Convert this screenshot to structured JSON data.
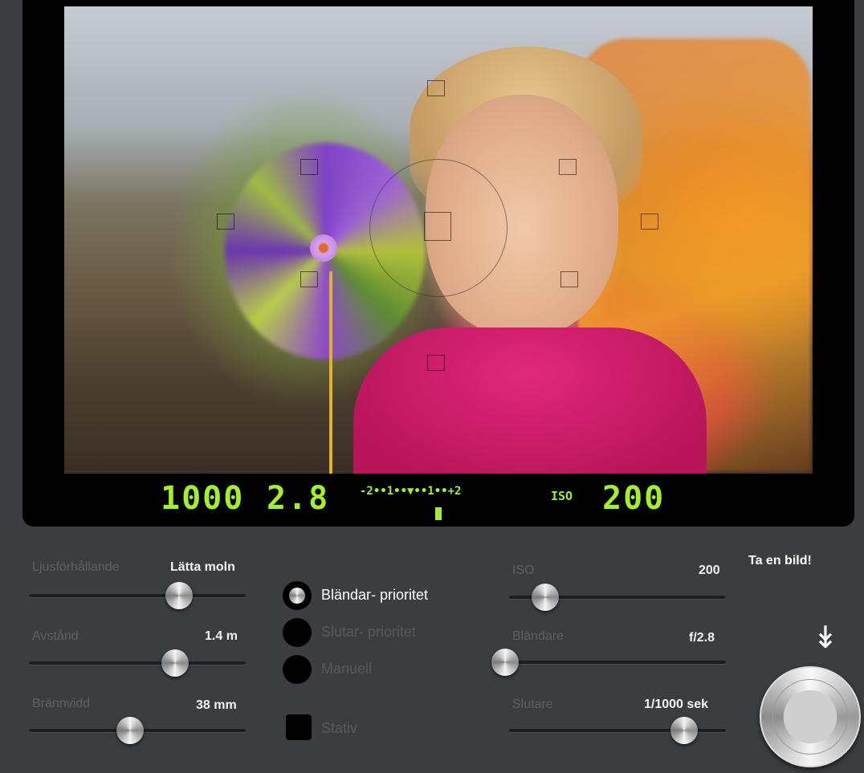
{
  "viewfinder": {
    "shutter_readout": "1000",
    "aperture_readout": "2.8",
    "meter_scale": "-2••1••▼••1••+2",
    "iso_label": "ISO",
    "iso_readout": "200"
  },
  "left_controls": {
    "light": {
      "label": "Ljusförhållande",
      "value": "Lätta moln",
      "level": 0.72
    },
    "distance": {
      "label": "Avstånd",
      "value": "1.4 m",
      "level": 0.7
    },
    "focal": {
      "label": "Brännvidd",
      "value": "38 mm",
      "level": 0.46
    }
  },
  "modes": [
    {
      "label": "Bländar- prioritet",
      "selected": true
    },
    {
      "label": "Slutar- prioritet",
      "selected": false
    },
    {
      "label": "Manuell",
      "selected": false
    }
  ],
  "tripod": {
    "label": "Stativ",
    "checked": false
  },
  "right_controls": {
    "iso": {
      "label": "ISO",
      "value": "200",
      "level": 0.12
    },
    "aperture": {
      "label": "Bländare",
      "value": "f/2.8",
      "level": 0.0
    },
    "shutter": {
      "label": "Slutare",
      "value": "1/1000 sek",
      "level": 0.85
    }
  },
  "shoot": {
    "label": "Ta en bild!",
    "arrow": "↡"
  },
  "colors": {
    "lcd": "#a3ef2a",
    "panel": "#3b3d40",
    "label_dim": "#5c6064"
  },
  "icons": [
    "pinwheel-photo",
    "af-point",
    "shutter-button-icon",
    "down-arrow-icon"
  ]
}
